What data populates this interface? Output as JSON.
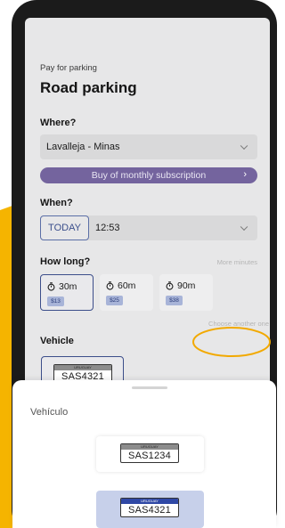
{
  "screen": {
    "caption": "Pay for parking",
    "title": "Road parking"
  },
  "where": {
    "label": "Where?",
    "value": "Lavalleja - Minas",
    "subscribe_label": "Buy of monthly subscription",
    "subscribe_arrow": "›"
  },
  "when": {
    "label": "When?",
    "day": "TODAY",
    "time": "12:53"
  },
  "how_long": {
    "label": "How long?",
    "more_label": "More minutes",
    "options": [
      {
        "duration": "30m",
        "price": "$13",
        "selected": true
      },
      {
        "duration": "60m",
        "price": "$25",
        "selected": false
      },
      {
        "duration": "90m",
        "price": "$38",
        "selected": false
      }
    ]
  },
  "vehicle": {
    "label": "Vehicle",
    "choose_label": "Choose another one",
    "plate": {
      "country": "URUGUAY",
      "number": "SAS4321"
    }
  },
  "sheet": {
    "title": "Vehículo",
    "plates": [
      {
        "country": "URUGUAY",
        "number": "SAS1234",
        "selected": false
      },
      {
        "country": "URUGUAY",
        "number": "SAS4321",
        "selected": true
      }
    ]
  },
  "colors": {
    "accent_purple": "#74649e",
    "selected_blue": "#3c4e8a",
    "highlight_orange": "#f2a900"
  }
}
